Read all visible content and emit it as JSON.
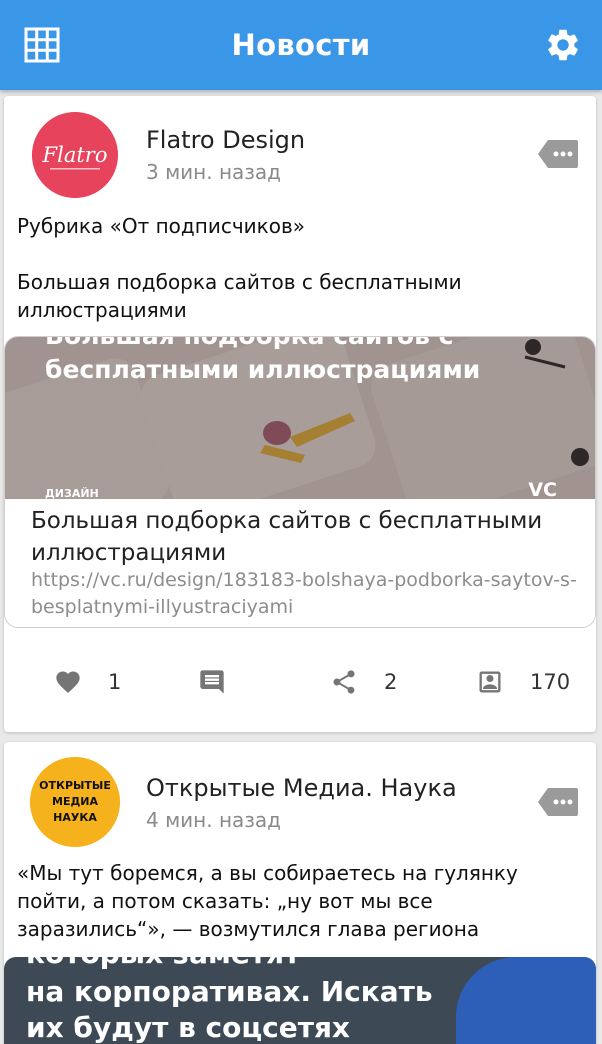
{
  "app": {
    "title": "Новости",
    "accent": "#3a97e8"
  },
  "icons": {
    "left": "grid-icon",
    "right": "gear-icon"
  },
  "posts": [
    {
      "author": "Flatro Design",
      "avatar_text": "Flatro",
      "time": "3 мин. назад",
      "text": "Рубрика «От подписчиков»\n\nБольшая подборка сайтов с бесплатными иллюстрациями",
      "preview": {
        "image_line1": "Большая подборка сайтов с",
        "image_line2": "бесплатными иллюстрациями",
        "image_rubric": "ДИЗАЙН",
        "image_brand": "VC",
        "title": "Большая подборка сайтов с бесплатными иллюстрациями",
        "url": "https://vc.ru/design/183183-bolshaya-podborka-saytov-s-besplatnymi-illyustraciyami"
      },
      "likes": "1",
      "shares": "2",
      "views": "170"
    },
    {
      "author": "Открытые Медиа. Наука",
      "avatar_text_1": "ОТКРЫТЫЕ",
      "avatar_text_2": "МЕДИА",
      "avatar_text_3": "НАУКА",
      "time": "4 мин. назад",
      "text": "«Мы тут боремся, а вы собираетесь на гулянку пойти, а потом сказать: „ну вот мы все заразились“», — возмутился глава региона",
      "preview": {
        "image_line1": "которых заметят",
        "image_line2": "на корпоративах. Искать",
        "image_line3": "их будут в соцсетях"
      }
    }
  ]
}
